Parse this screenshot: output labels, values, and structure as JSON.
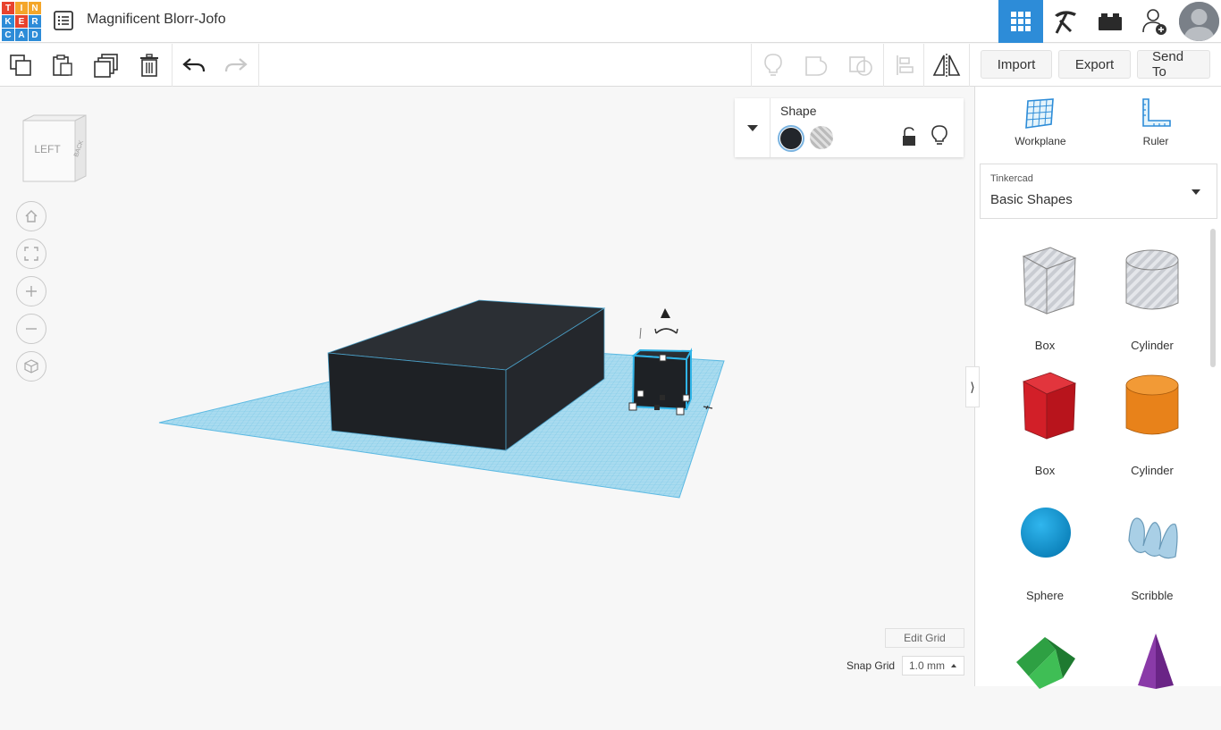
{
  "app": {
    "logo_letters": [
      "T",
      "I",
      "N",
      "K",
      "E",
      "R",
      "C",
      "A",
      "D"
    ],
    "logo_colors": [
      "#e8432e",
      "#f4a62a",
      "#f4a62a",
      "#2d8cd8",
      "#e8432e",
      "#2d8cd8",
      "#2d8cd8",
      "#2d8cd8",
      "#2d8cd8"
    ],
    "design_title": "Magnificent Blorr-Jofo",
    "accent_color": "#2d8cd8"
  },
  "toolbar": {
    "import_label": "Import",
    "export_label": "Export",
    "send_to_label": "Send To"
  },
  "canvas": {
    "view_cube_face": "LEFT",
    "view_cube_side": "BACK",
    "shape_inspector": {
      "title": "Shape",
      "solid_color": "#22262b"
    },
    "edit_grid_label": "Edit Grid",
    "snap_grid_label": "Snap Grid",
    "snap_grid_value": "1.0 mm"
  },
  "panel": {
    "workplane_label": "Workplane",
    "ruler_label": "Ruler",
    "library_provider": "Tinkercad",
    "library_name": "Basic Shapes",
    "shapes": [
      {
        "label": "Box",
        "icon": "box-hole-icon"
      },
      {
        "label": "Cylinder",
        "icon": "cylinder-hole-icon"
      },
      {
        "label": "Box",
        "icon": "box-red-icon"
      },
      {
        "label": "Cylinder",
        "icon": "cylinder-orange-icon"
      },
      {
        "label": "Sphere",
        "icon": "sphere-icon"
      },
      {
        "label": "Scribble",
        "icon": "scribble-icon"
      },
      {
        "label": "",
        "icon": "roof-icon"
      },
      {
        "label": "",
        "icon": "cone-icon"
      }
    ]
  }
}
